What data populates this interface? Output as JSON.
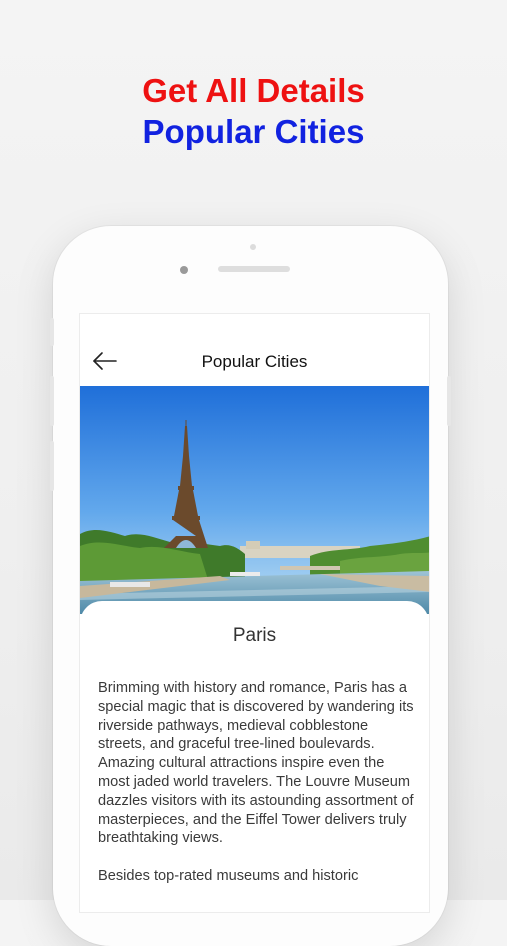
{
  "promo": {
    "line1": "Get All Details",
    "line2": "Popular Cities",
    "line1_color": "#ee1111",
    "line2_color": "#1122e0"
  },
  "appbar": {
    "back_icon": "arrow-left-icon",
    "title": "Popular Cities"
  },
  "city": {
    "name": "Paris",
    "image": "eiffel-tower-seine-photo",
    "paragraphs": [
      "Brimming with history and romance, Paris has a special magic that is discovered by wandering its riverside pathways, medieval cobblestone streets, and graceful tree-lined boulevards. Amazing cultural attractions inspire even the most jaded world travelers. The Louvre Museum dazzles visitors with its astounding assortment of masterpieces, and the Eiffel Tower delivers truly breathtaking views.",
      "Besides top-rated museums and historic"
    ]
  }
}
